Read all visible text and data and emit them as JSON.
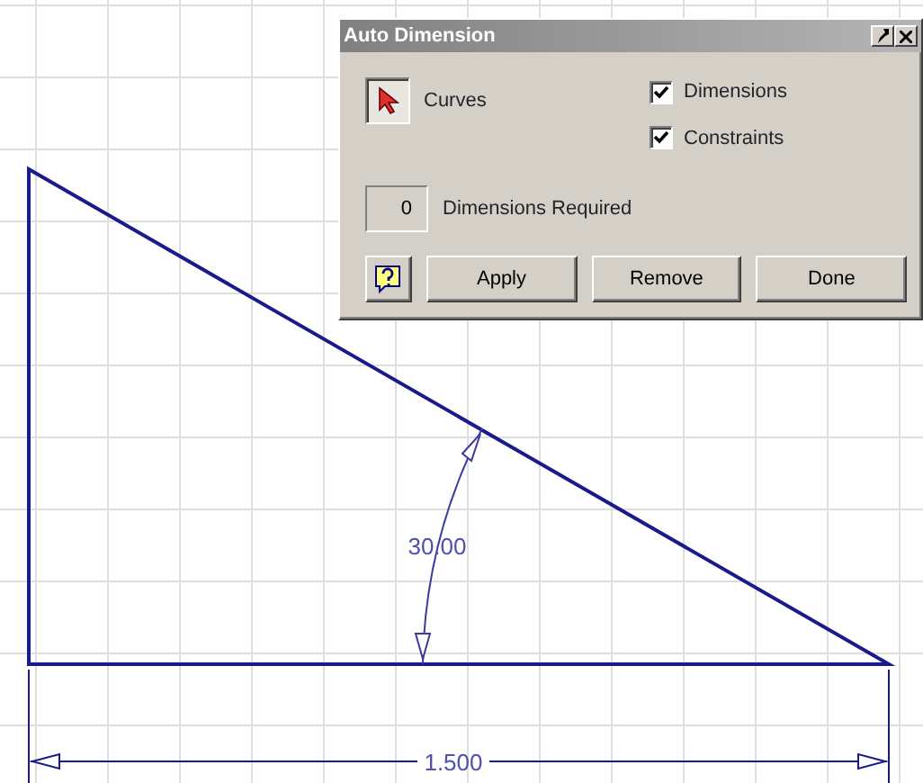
{
  "sketch": {
    "angle_dimension": "30.00",
    "length_dimension": "1.500"
  },
  "dialog": {
    "title": "Auto Dimension",
    "curves": {
      "label": "Curves",
      "selected": true
    },
    "checkboxes": [
      {
        "label": "Dimensions",
        "checked": true
      },
      {
        "label": "Constraints",
        "checked": true
      }
    ],
    "required": {
      "value": "0",
      "label": "Dimensions Required"
    },
    "buttons": [
      "Apply",
      "Remove",
      "Done"
    ]
  }
}
